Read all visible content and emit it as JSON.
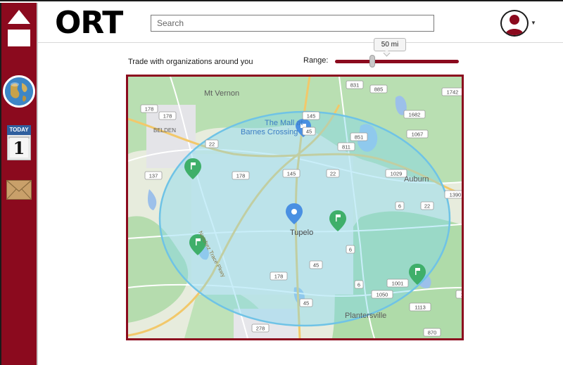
{
  "app": {
    "brand": "ORT"
  },
  "header": {
    "search_placeholder": "Search"
  },
  "sidebar": {
    "calendar_month": "TODAY",
    "calendar_day": "1"
  },
  "controls": {
    "tagline": "Trade with organizations around you",
    "range_label": "Range:",
    "range_value": "50 mi",
    "range_fraction": 0.29
  },
  "map": {
    "labels": {
      "mt_vernon": "Mt Vernon",
      "mall_line1": "The Mall at",
      "mall_line2": "Barnes Crossing",
      "belden": "BELDEN",
      "auburn": "Auburn",
      "tupelo": "Tupelo",
      "plantersville": "Plantersville",
      "parkway": "Natchez Trace Pkwy"
    },
    "route_shields": [
      "831",
      "885",
      "1742",
      "1682",
      "1067",
      "851",
      "811",
      "1029",
      "1390",
      "145",
      "45",
      "178",
      "137",
      "178",
      "145",
      "22",
      "22",
      "22",
      "6",
      "6",
      "45",
      "178",
      "1001",
      "1050",
      "6",
      "1113",
      "1279",
      "278",
      "870",
      "45",
      "178"
    ],
    "colors": {
      "accent": "#8b0a1e",
      "range_circle": "#7fd7f0",
      "park": "#a8dcb1",
      "water": "#8ab4e8",
      "marker_green": "#3faf6a",
      "marker_blue": "#4a90e2"
    }
  }
}
